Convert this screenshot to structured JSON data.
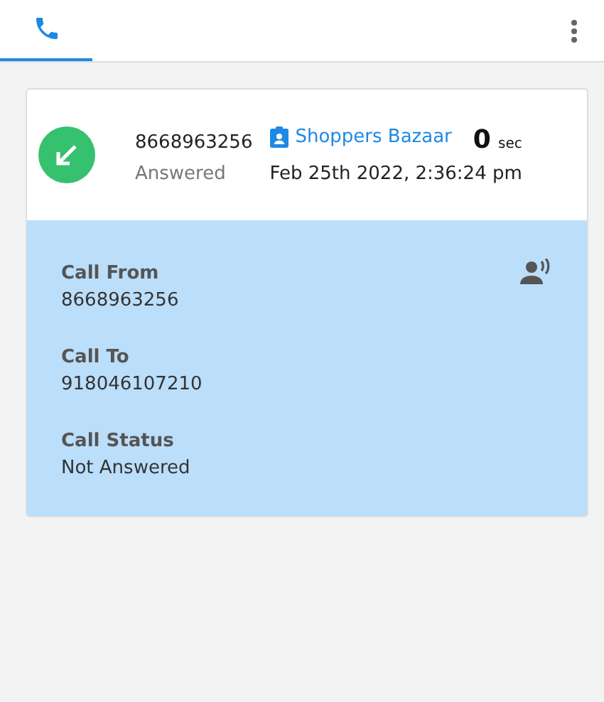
{
  "tabs": [
    {
      "kind": "phone",
      "selected": true
    }
  ],
  "call": {
    "kind": "incoming",
    "number": "8668963256",
    "status": "Answered",
    "contact": "Shoppers Bazaar",
    "duration": "0",
    "duration_unit": "sec",
    "datetime": "Feb 25th 2022, 2:36:24 pm"
  },
  "details": [
    {
      "label": "Call From",
      "value": "8668963256"
    },
    {
      "label": "Call To",
      "value": "918046107210"
    },
    {
      "label": "Call Status",
      "value": "Not Answered"
    }
  ]
}
